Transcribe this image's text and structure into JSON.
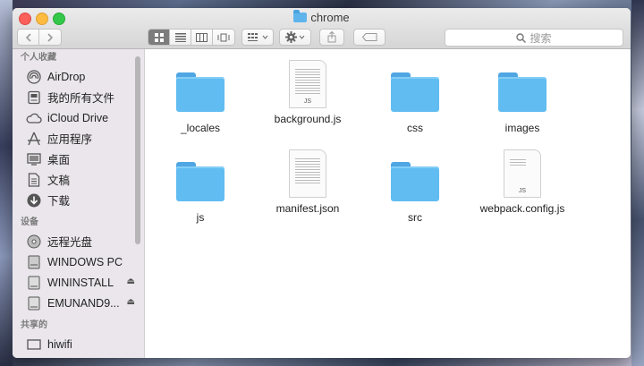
{
  "window": {
    "title": "chrome"
  },
  "search": {
    "placeholder": "搜索"
  },
  "sidebar": {
    "sections": [
      {
        "header": "个人收藏",
        "items": [
          {
            "label": "AirDrop",
            "icon": "airdrop-icon"
          },
          {
            "label": "我的所有文件",
            "icon": "all-files-icon"
          },
          {
            "label": "iCloud Drive",
            "icon": "cloud-icon"
          },
          {
            "label": "应用程序",
            "icon": "applications-icon"
          },
          {
            "label": "桌面",
            "icon": "desktop-icon"
          },
          {
            "label": "文稿",
            "icon": "documents-icon"
          },
          {
            "label": "下载",
            "icon": "download-icon"
          }
        ]
      },
      {
        "header": "设备",
        "items": [
          {
            "label": "远程光盘",
            "icon": "disc-icon"
          },
          {
            "label": "WINDOWS PC",
            "icon": "computer-icon"
          },
          {
            "label": "WININSTALL",
            "icon": "drive-icon"
          },
          {
            "label": "EMUNAND9...",
            "icon": "drive-icon"
          }
        ]
      },
      {
        "header": "共享的",
        "items": [
          {
            "label": "hiwifi",
            "icon": "network-icon"
          }
        ]
      }
    ]
  },
  "files": [
    {
      "name": "_locales",
      "kind": "folder"
    },
    {
      "name": "background.js",
      "kind": "js"
    },
    {
      "name": "css",
      "kind": "folder"
    },
    {
      "name": "images",
      "kind": "folder"
    },
    {
      "name": "js",
      "kind": "folder"
    },
    {
      "name": "manifest.json",
      "kind": "doc"
    },
    {
      "name": "src",
      "kind": "folder"
    },
    {
      "name": "webpack.config.js",
      "kind": "js"
    }
  ],
  "file_ext_labels": {
    "js": "JS"
  },
  "colors": {
    "folder": "#60bcf1",
    "close": "#fc605b",
    "minimize": "#fdbc40",
    "maximize": "#34c84a"
  }
}
